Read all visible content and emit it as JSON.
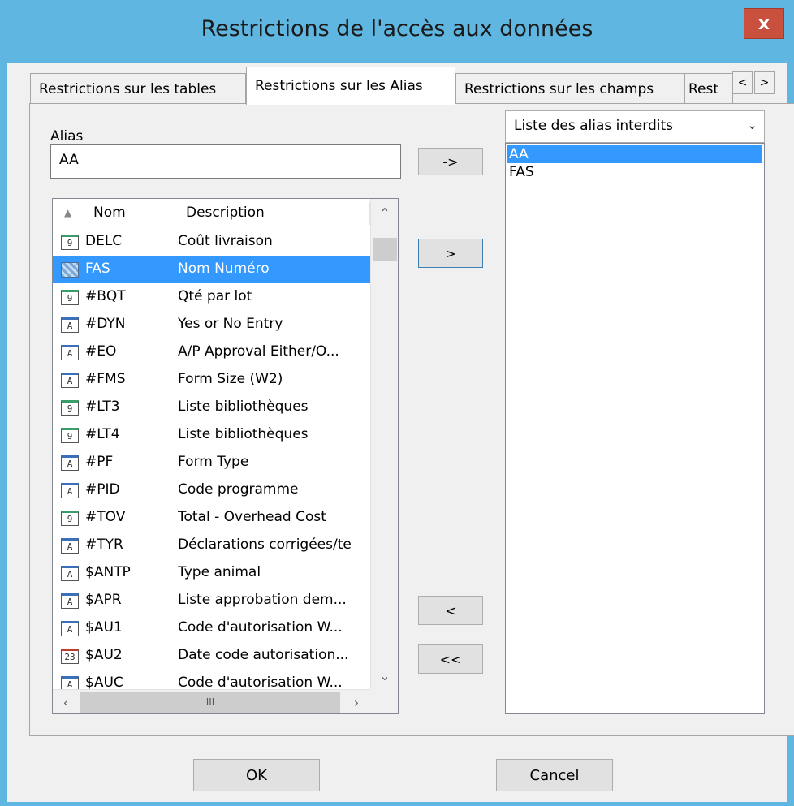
{
  "window": {
    "title": "Restrictions de l'accès aux données",
    "close_label": "x"
  },
  "tabs": [
    {
      "label": "Restrictions sur les tables"
    },
    {
      "label": "Restrictions sur les Alias"
    },
    {
      "label": "Restrictions sur les champs"
    },
    {
      "label": "Rest"
    }
  ],
  "tab_scroll": {
    "left": "<",
    "right": ">"
  },
  "alias": {
    "label": "Alias",
    "value": "AA"
  },
  "buttons": {
    "add_alias": "->",
    "add_selected": ">",
    "remove_selected": "<",
    "remove_all": "<<",
    "ok": "OK",
    "cancel": "Cancel"
  },
  "list": {
    "headers": {
      "sort_icon": "▲",
      "nom": "Nom",
      "description": "Description"
    },
    "rows": [
      {
        "icon": "9",
        "type": "num",
        "nom": "DELC",
        "desc": "Coût livraison",
        "selected": false
      },
      {
        "icon": "",
        "type": "pattern",
        "nom": "FAS",
        "desc": "Nom Numéro",
        "selected": true
      },
      {
        "icon": "9",
        "type": "num",
        "nom": "#BQT",
        "desc": "Qté par lot",
        "selected": false
      },
      {
        "icon": "A",
        "type": "alpha",
        "nom": "#DYN",
        "desc": "Yes or No Entry",
        "selected": false
      },
      {
        "icon": "A",
        "type": "alpha",
        "nom": "#EO",
        "desc": "A/P Approval Either/O...",
        "selected": false
      },
      {
        "icon": "A",
        "type": "alpha",
        "nom": "#FMS",
        "desc": "Form Size (W2)",
        "selected": false
      },
      {
        "icon": "9",
        "type": "num",
        "nom": "#LT3",
        "desc": "Liste bibliothèques",
        "selected": false
      },
      {
        "icon": "9",
        "type": "num",
        "nom": "#LT4",
        "desc": "Liste bibliothèques",
        "selected": false
      },
      {
        "icon": "A",
        "type": "alpha",
        "nom": "#PF",
        "desc": "Form Type",
        "selected": false
      },
      {
        "icon": "A",
        "type": "alpha",
        "nom": "#PID",
        "desc": "Code programme",
        "selected": false
      },
      {
        "icon": "9",
        "type": "num",
        "nom": "#TOV",
        "desc": "Total - Overhead Cost",
        "selected": false
      },
      {
        "icon": "A",
        "type": "alpha",
        "nom": "#TYR",
        "desc": "Déclarations corrigées/te",
        "selected": false
      },
      {
        "icon": "A",
        "type": "alpha",
        "nom": "$ANTP",
        "desc": "Type animal",
        "selected": false
      },
      {
        "icon": "A",
        "type": "alpha",
        "nom": "$APR",
        "desc": "Liste approbation dem...",
        "selected": false
      },
      {
        "icon": "A",
        "type": "alpha",
        "nom": "$AU1",
        "desc": "Code d'autorisation W...",
        "selected": false
      },
      {
        "icon": "23",
        "type": "date",
        "nom": "$AU2",
        "desc": "Date code autorisation...",
        "selected": false
      },
      {
        "icon": "A",
        "type": "alpha",
        "nom": "$AUC",
        "desc": "Code d'autorisation W...",
        "selected": false
      }
    ],
    "hscroll_thumb": "III"
  },
  "forbidden": {
    "combo_value": "Liste des alias interdits",
    "items": [
      {
        "label": "AA",
        "selected": true
      },
      {
        "label": "FAS",
        "selected": false
      }
    ]
  }
}
